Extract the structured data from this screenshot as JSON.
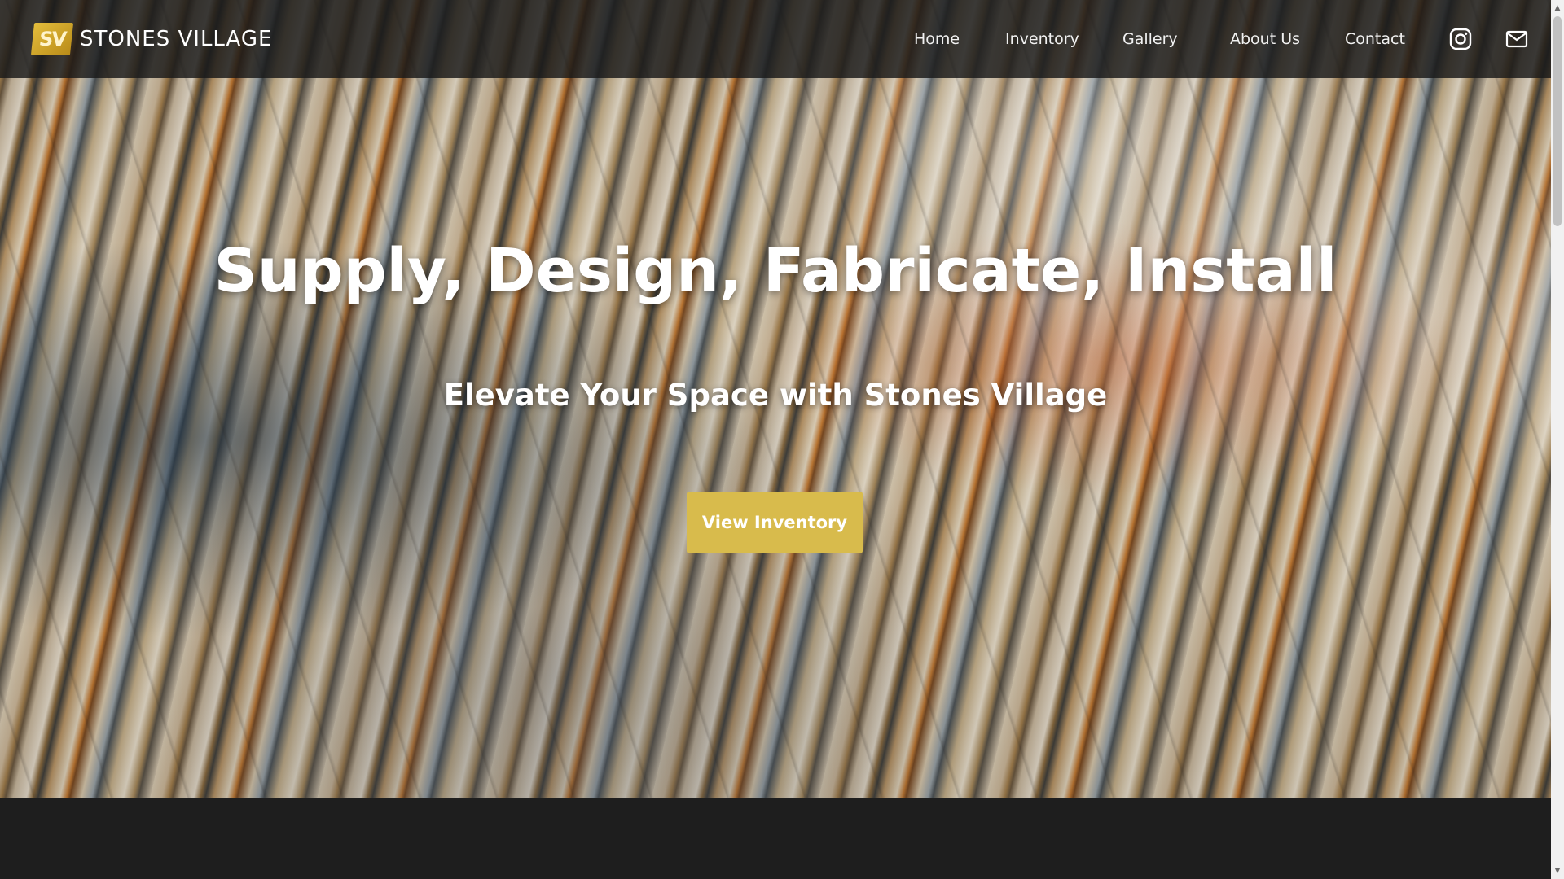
{
  "brand": {
    "logo_mark": "SV",
    "name": "STONES VILLAGE"
  },
  "nav": {
    "links": [
      {
        "label": "Home"
      },
      {
        "label": "Inventory"
      },
      {
        "label": "Gallery"
      },
      {
        "label": "About Us"
      },
      {
        "label": "Contact"
      }
    ],
    "icons": [
      "instagram-icon",
      "mail-icon"
    ]
  },
  "hero": {
    "title": "Supply, Design, Fabricate, Install",
    "subtitle": "Elevate Your Space with Stones Village",
    "cta_label": "View Inventory"
  },
  "colors": {
    "accent": "#d8bb4c",
    "navbar_bg": "#191919",
    "lower_bg": "#1e1e1e"
  }
}
